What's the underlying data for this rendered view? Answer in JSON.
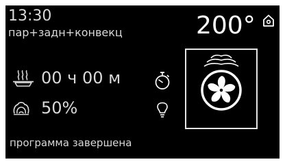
{
  "header": {
    "time": "13:30",
    "mode": "пар+задн+конвекц",
    "temperature": "200°"
  },
  "cooking": {
    "time_label": "00 ч 00 м",
    "humidity_label": "50%"
  },
  "status": "программа завершена",
  "icons": {
    "home": "home-icon",
    "steam_dish": "steam-dish-icon",
    "humidity": "humidity-icon",
    "timer": "timer-icon",
    "lamp": "lamp-icon",
    "fan": "convection-fan-icon"
  },
  "colors": {
    "background": "#000000",
    "text": "#d9d9d9",
    "accent": "#ffffff"
  }
}
